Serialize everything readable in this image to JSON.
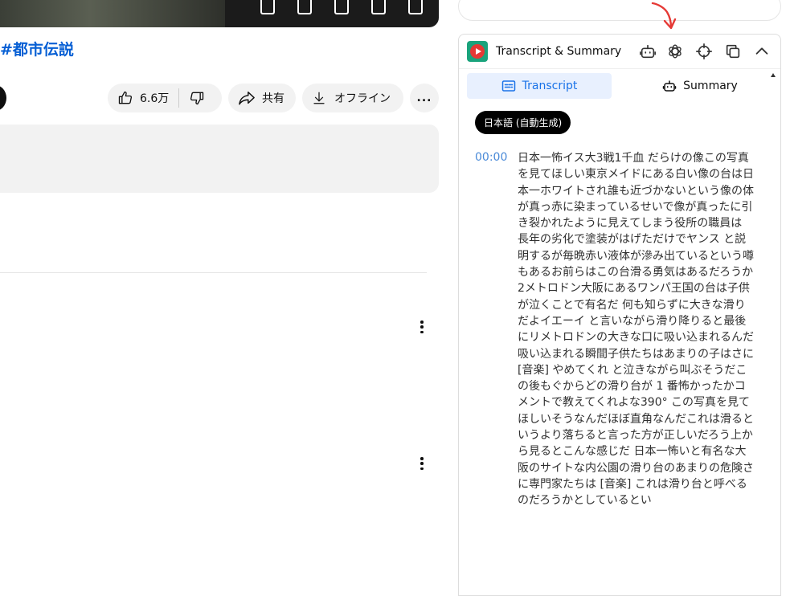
{
  "video": {
    "title": "#都市伝説",
    "like_count": "6.6万",
    "share_label": "共有",
    "offline_label": "オフライン",
    "more_label": "..."
  },
  "panel": {
    "title": "Transcript & Summary",
    "tabs": {
      "transcript": "Transcript",
      "summary": "Summary"
    },
    "language_chip": "日本語 (自動生成)",
    "segments": [
      {
        "timestamp": "00:00",
        "text": "日本一怖イス大3戦1千血 だらけの像この写真を見てほしい東京メイドにある白い像の台は日本一ホワイトされ誰も近づかないという像の体が真っ赤に染まっているせいで像が真ったに引き裂かれたように見えてしまう役所の職員は 長年の劣化で塗装がはげただけでヤンス と説明するが毎晩赤い液体が滲み出ているという噂もあるお前らはこの台滑る勇気はあるだろうか 2メトロドン大阪にあるワンパ王国の台は子供が泣くことで有名だ 何も知らずに大きな滑りだよイエーイ と言いながら滑り降りると最後にリメトロドンの大きな口に吸い込まれるんだ吸い込まれる瞬間子供たちはあまりの子はさに [音楽] やめてくれ と泣きながら叫ぶそうだこの後もぐからどの滑り台が 1 番怖かったかコメントで教えてくれよな390° この写真を見てほしいそうなんだほぼ直角なんだこれは滑るというより落ちると言った方が正しいだろう上から見るとこんな感じだ 日本一怖いと有名な大阪のサイトな内公園の滑り台のあまりの危険さに専門家たちは [音楽] これは滑り台と呼べるのだろうかとしているとい"
      }
    ]
  },
  "colors": {
    "accent": "#1a73e8",
    "timestamp": "#4a8ad8",
    "title_link": "#065fd4",
    "annotation_arrow": "#e53935"
  }
}
